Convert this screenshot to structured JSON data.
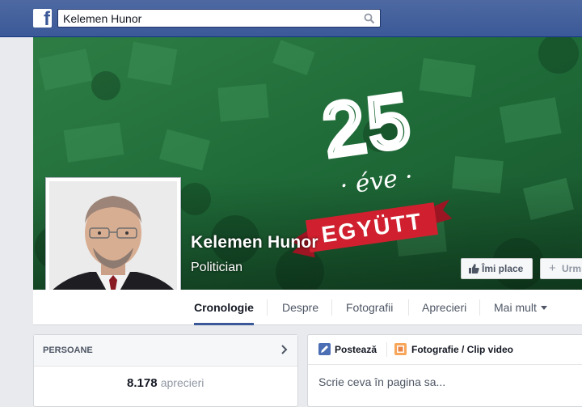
{
  "topbar": {
    "logo": "f",
    "search_value": "Kelemen Hunor",
    "brand_color": "#3b5998"
  },
  "cover": {
    "number": "25",
    "subtitle": "· éve ·",
    "ribbon_text": "EGYÜTT",
    "background": "#1d6b38",
    "ribbon_color": "#c41e2e"
  },
  "profile": {
    "name": "Kelemen Hunor",
    "role": "Politician"
  },
  "actions": {
    "like_label": "Îmi place",
    "follow_label": "Urm"
  },
  "tabs": [
    {
      "label": "Cronologie",
      "active": true
    },
    {
      "label": "Despre"
    },
    {
      "label": "Fotografii"
    },
    {
      "label": "Aprecieri"
    },
    {
      "label": "Mai mult"
    }
  ],
  "people": {
    "title": "PERSOANE",
    "likes_count": "8.178",
    "likes_label": "aprecieri"
  },
  "composer": {
    "post_label": "Postează",
    "photo_label": "Fotografie / Clip video",
    "placeholder": "Scrie ceva în pagina sa..."
  }
}
